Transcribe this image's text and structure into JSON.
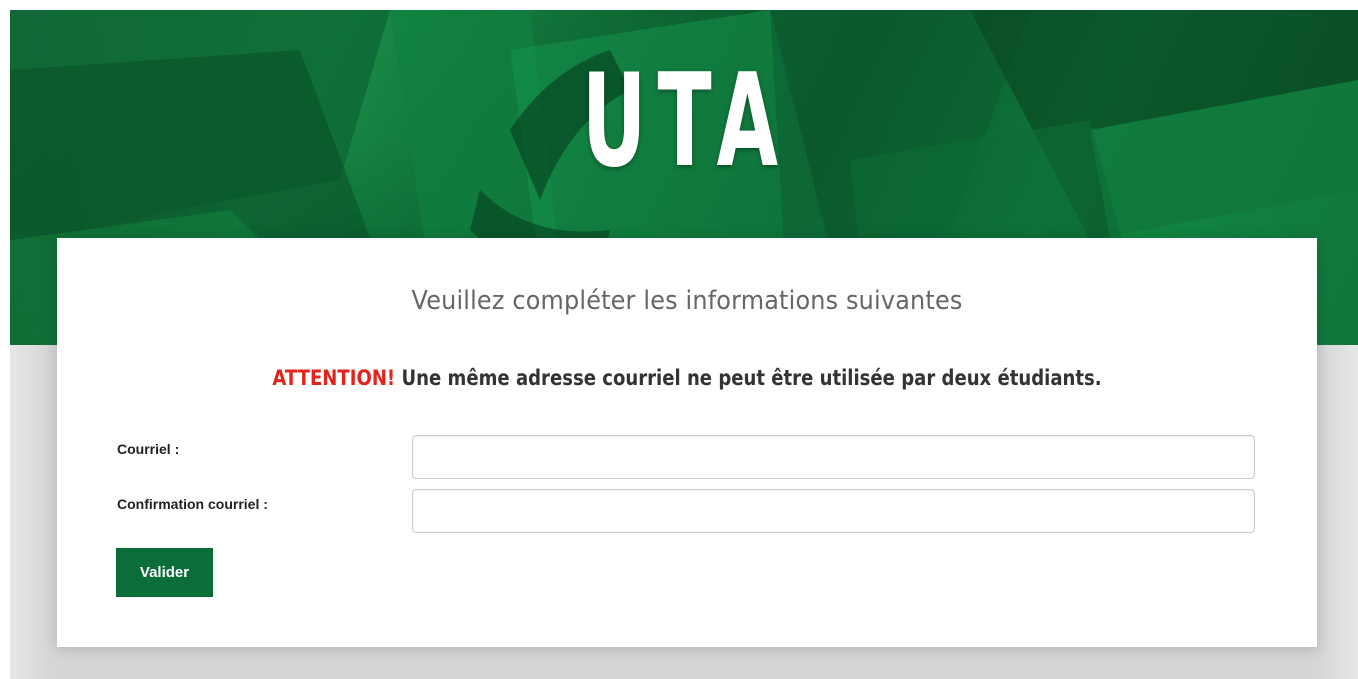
{
  "hero": {
    "title": "UTA"
  },
  "card": {
    "heading": "Veuillez compléter les informations suivantes",
    "attention_prefix": "ATTENTION!",
    "attention_text": " Une même adresse courriel ne peut être utilisée par deux étudiants."
  },
  "form": {
    "email_label": "Courriel :",
    "email_value": "",
    "confirm_label": "Confirmation courriel :",
    "confirm_value": "",
    "submit_label": "Valider"
  },
  "colors": {
    "brand_green": "#0b6e3a",
    "warning_red": "#e2241c"
  }
}
